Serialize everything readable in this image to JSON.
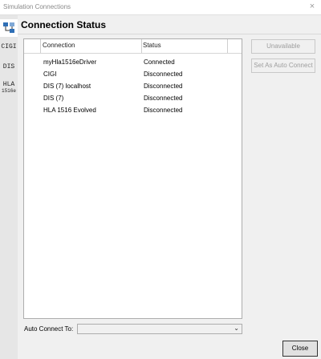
{
  "window": {
    "title": "Simulation Connections",
    "close_glyph": "×"
  },
  "sidebar": {
    "items": [
      {
        "icon": "network-icon",
        "label": ""
      },
      {
        "label": "CIGI"
      },
      {
        "label": "DIS"
      },
      {
        "label": "HLA",
        "sublabel": "1516e"
      }
    ]
  },
  "page": {
    "title": "Connection Status"
  },
  "table": {
    "headers": [
      "Connection",
      "Status"
    ],
    "rows": [
      {
        "connection": "myHla1516eDriver",
        "status": "Connected"
      },
      {
        "connection": "CIGI",
        "status": "Disconnected"
      },
      {
        "connection": "DIS (7) localhost",
        "status": "Disconnected"
      },
      {
        "connection": "DIS (7)",
        "status": "Disconnected"
      },
      {
        "connection": "HLA 1516 Evolved",
        "status": "Disconnected"
      }
    ]
  },
  "actions": {
    "unavailable_label": "Unavailable",
    "set_auto_connect_label": "Set As Auto Connect"
  },
  "auto_connect": {
    "label": "Auto Connect To:",
    "value": ""
  },
  "footer": {
    "close_label": "Close"
  },
  "colors": {
    "disabled_text": "#9d9d9d",
    "active_tab": "#ffffff",
    "icon_blue": "#2f6fb5"
  }
}
